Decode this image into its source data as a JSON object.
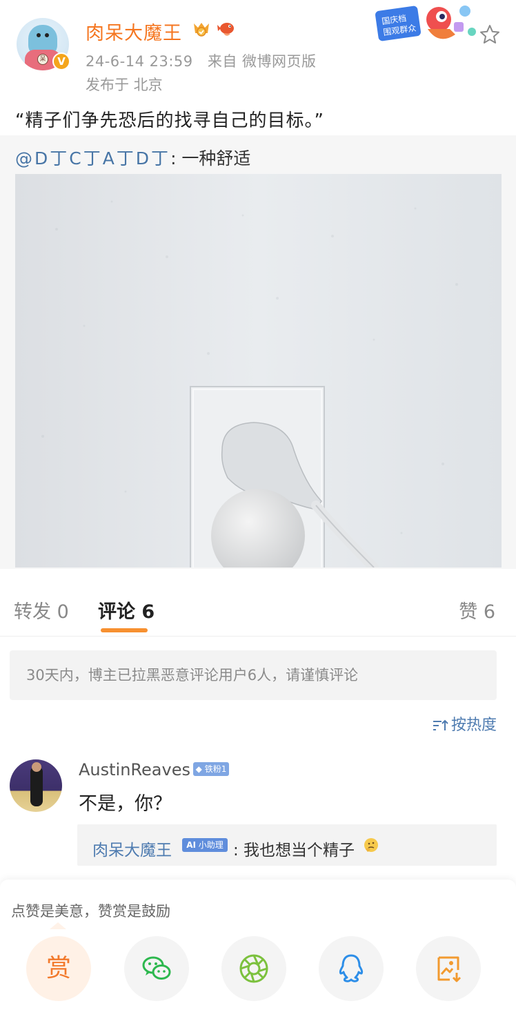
{
  "post": {
    "username": "肉呆大魔王",
    "verified_mark": "V",
    "timestamp": "24-6-14 23:59",
    "source": "来自 微博网页版",
    "location": "发布于 北京",
    "event_badge_text": "国庆档 围观群众",
    "text": "“精子们争先恐后的找寻自己的目标。”"
  },
  "repost": {
    "mention": "@D丁C丁A丁D丁",
    "text": ": 一种舒适"
  },
  "tabs": {
    "repost_label": "转发 0",
    "comments_label": "评论 6",
    "likes_label": "赞 6"
  },
  "notice": "30天内，博主已拉黑恶意评论用户6人，请谨慎评论",
  "sort_label": "按热度",
  "comment": {
    "user": "AustinReaves",
    "fan_badge": "铁粉1",
    "text": "不是，你？",
    "reply": {
      "user": "肉呆大魔王",
      "badge": "小助理",
      "text": ": 我也想当个精子"
    }
  },
  "share_sheet": {
    "caption": "点赞是美意，赞赏是鼓励",
    "reward_label": "赏",
    "icons": [
      "wechat-icon",
      "moments-icon",
      "qq-icon",
      "save-image-icon"
    ]
  },
  "colors": {
    "username": "#f57620",
    "link": "#4e7bb0",
    "tab_underline": "#f79030"
  }
}
